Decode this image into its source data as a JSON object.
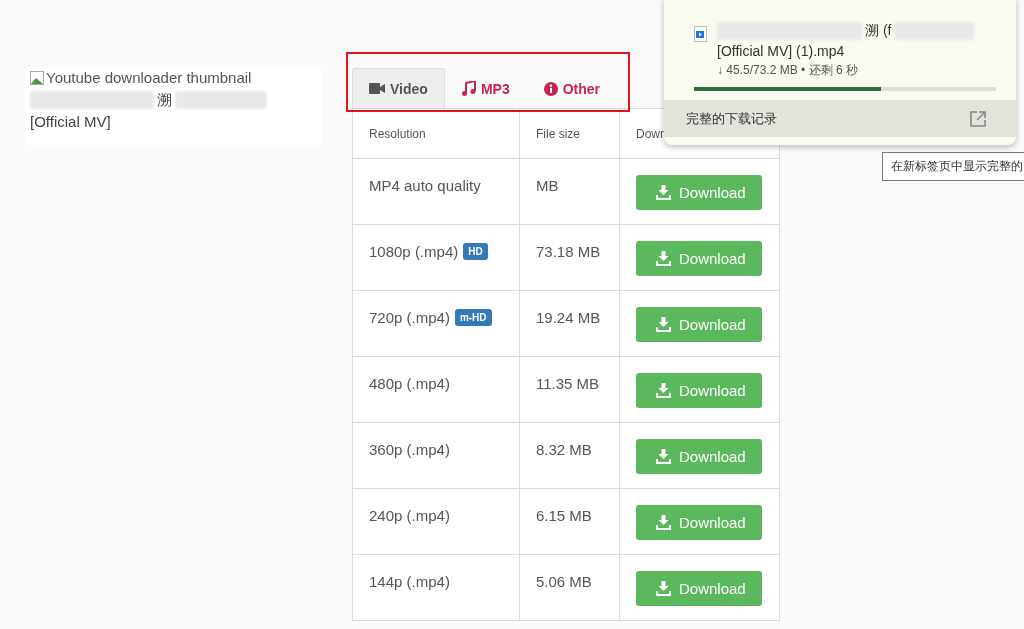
{
  "preview": {
    "image_alt": "Youtube downloader thumbnail",
    "title_char": "溯",
    "title_line2": "[Official MV]"
  },
  "tabs": [
    {
      "label": "Video",
      "kind": "video",
      "selected": true
    },
    {
      "label": "MP3",
      "kind": "music",
      "selected": false
    },
    {
      "label": "Other",
      "kind": "info",
      "selected": false
    }
  ],
  "table": {
    "columns": [
      "Resolution",
      "File size",
      "Down"
    ],
    "rows": [
      {
        "resolution": "MP4 auto quality",
        "size": "MB",
        "button": "Download"
      },
      {
        "resolution": "1080p (.mp4)",
        "badge": "HD",
        "size": "73.18 MB",
        "button": "Download"
      },
      {
        "resolution": "720p (.mp4)",
        "badge": "m-HD",
        "size": "19.24 MB",
        "button": "Download"
      },
      {
        "resolution": "480p (.mp4)",
        "size": "11.35 MB",
        "button": "Download"
      },
      {
        "resolution": "360p (.mp4)",
        "size": "8.32 MB",
        "button": "Download"
      },
      {
        "resolution": "240p (.mp4)",
        "size": "6.15 MB",
        "button": "Download"
      },
      {
        "resolution": "144p (.mp4)",
        "size": "5.06 MB",
        "button": "Download"
      }
    ]
  },
  "download_panel": {
    "file_char": "溯 (f",
    "file_line2": "[Official MV] (1).mp4",
    "progress_text": "↓ 45.5/73.2 MB • 还剩 6 秒",
    "level": 0.62,
    "history_label": "完整的下载记录"
  },
  "tooltip": "在新标签页中显示完整的"
}
